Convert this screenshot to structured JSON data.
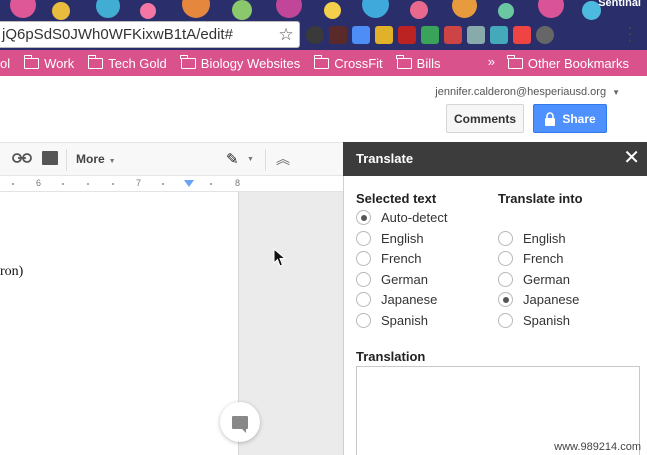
{
  "browser": {
    "corner_text": "Sentinal",
    "url": "jQ6pSdS0JWh0WFKixwB1tA/edit#",
    "extension_colors": [
      "#3a3a3a",
      "#5a2a2a",
      "#4d8df5",
      "#e2b12a",
      "#b22",
      "#3aa35a",
      "#c44",
      "#8aa",
      "#4ab",
      "#e44",
      "#666"
    ],
    "bookmarks": [
      {
        "label": "ol",
        "folder": false
      },
      {
        "label": "Work",
        "folder": true
      },
      {
        "label": "Tech Gold",
        "folder": true
      },
      {
        "label": "Biology Websites",
        "folder": true
      },
      {
        "label": "CrossFit",
        "folder": true
      },
      {
        "label": "Bills",
        "folder": true
      }
    ],
    "bookmarks_overflow": "»",
    "other_bookmarks": "Other Bookmarks",
    "bookmark_bar_color": "#d9528c"
  },
  "docs": {
    "account_email": "jennifer.calderon@hesperiausd.org",
    "comments_label": "Comments",
    "share_label": "Share",
    "toolbar_more": "More",
    "ruler_ticks": [
      "6",
      "7",
      "8"
    ],
    "doc_text": "ron)"
  },
  "translate": {
    "title": "Translate",
    "close": "✕",
    "selected_text_head": "Selected text",
    "translate_into_head": "Translate into",
    "source_options": [
      {
        "label": "Auto-detect",
        "checked": true
      },
      {
        "label": "English",
        "checked": false
      },
      {
        "label": "French",
        "checked": false
      },
      {
        "label": "German",
        "checked": false
      },
      {
        "label": "Japanese",
        "checked": false
      },
      {
        "label": "Spanish",
        "checked": false
      }
    ],
    "target_options": [
      {
        "label": "English",
        "checked": false
      },
      {
        "label": "French",
        "checked": false
      },
      {
        "label": "German",
        "checked": false
      },
      {
        "label": "Japanese",
        "checked": true
      },
      {
        "label": "Spanish",
        "checked": false
      }
    ],
    "translation_head": "Translation",
    "translation_value": ""
  },
  "watermark": "www.989214.com"
}
